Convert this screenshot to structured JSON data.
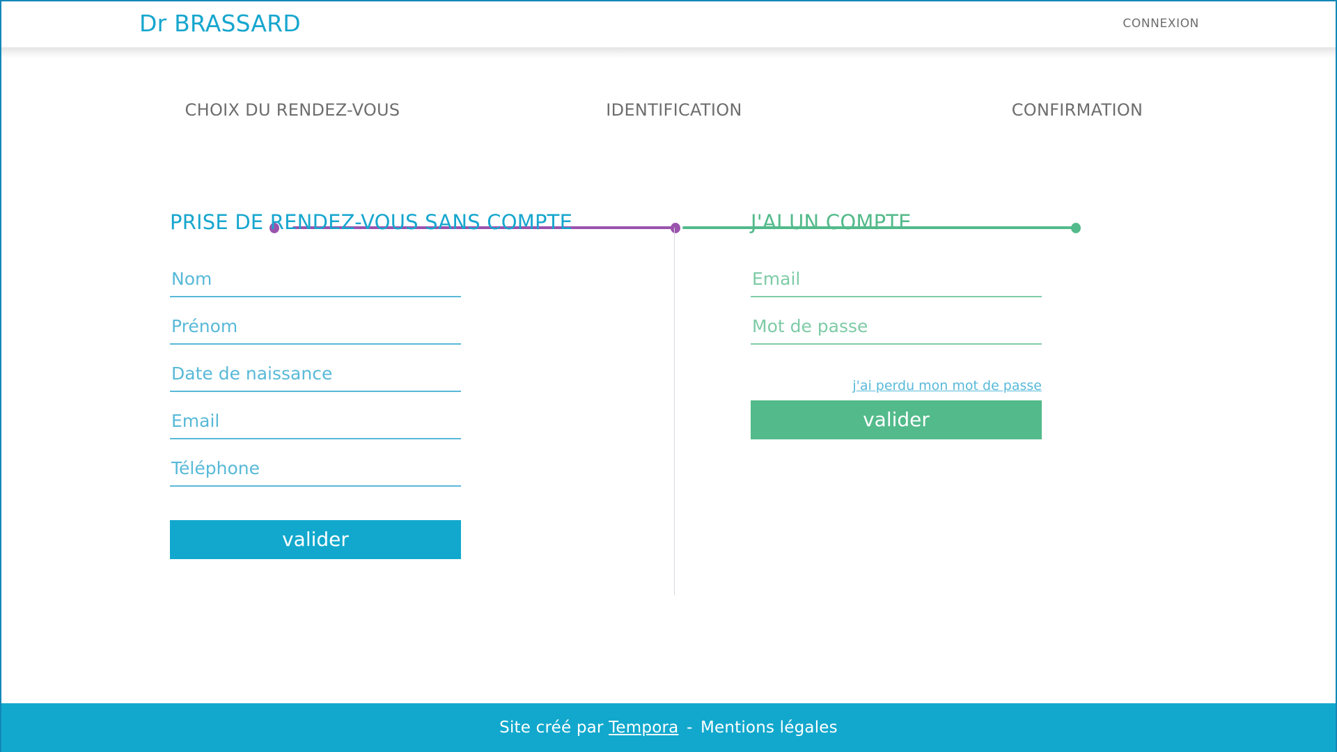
{
  "header": {
    "brand": "Dr BRASSARD",
    "login_label": "CONNEXION"
  },
  "stepper": {
    "steps": [
      {
        "label": "CHOIX DU RENDEZ-VOUS",
        "dot_color": "#9a54ad",
        "state": "done"
      },
      {
        "label": "IDENTIFICATION",
        "dot_color": "#9a54ad",
        "state": "current"
      },
      {
        "label": "CONFIRMATION",
        "dot_color": "#53ba8b",
        "state": "upcoming"
      }
    ],
    "connectors": [
      {
        "color": "#9a54ad"
      },
      {
        "color": "#53ba8b"
      }
    ]
  },
  "guest_panel": {
    "title": "PRISE DE RENDEZ-VOUS SANS COMPTE",
    "accent": "#16a6ce",
    "fields": [
      {
        "name": "nom",
        "placeholder": "Nom",
        "value": ""
      },
      {
        "name": "prenom",
        "placeholder": "Prénom",
        "value": ""
      },
      {
        "name": "date_de_naissance",
        "placeholder": "Date de naissance",
        "value": ""
      },
      {
        "name": "email",
        "placeholder": "Email",
        "value": ""
      },
      {
        "name": "telephone",
        "placeholder": "Téléphone",
        "value": ""
      }
    ],
    "submit_label": "valider",
    "submit_color": "#12a8cd"
  },
  "account_panel": {
    "title": "J'AI UN COMPTE",
    "accent": "#53ba8b",
    "fields": [
      {
        "name": "email",
        "placeholder": "Email",
        "value": ""
      },
      {
        "name": "mot_de_passe",
        "placeholder": "Mot de passe",
        "value": ""
      }
    ],
    "forgot_password_label": "j'ai perdu mon mot de passe",
    "submit_label": "valider",
    "submit_color": "#53ba8b"
  },
  "footer": {
    "prefix": "Site créé par",
    "link_label": "Tempora",
    "separator": "-",
    "legal_label": "Mentions légales",
    "background": "#12a8cd"
  }
}
